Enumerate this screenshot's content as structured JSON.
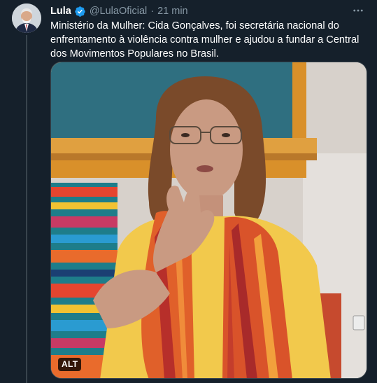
{
  "tweet": {
    "author_name": "Lula",
    "handle": "@LulaOficial",
    "separator": "·",
    "time": "21 min",
    "text": "Ministério da Mulher: Cida Gonçalves, foi secretária nacional do enfrentamento à violência contra mulher e ajudou a fundar a Central dos Movimentos Populares no Brasil.",
    "alt_badge": "ALT"
  },
  "colors": {
    "background": "#15202b",
    "secondary_text": "#8899a6",
    "verified_badge": "#1d9bf0",
    "divider": "#38444d"
  },
  "icons": {
    "verified": "verified-badge-icon",
    "more": "more-options-icon"
  }
}
